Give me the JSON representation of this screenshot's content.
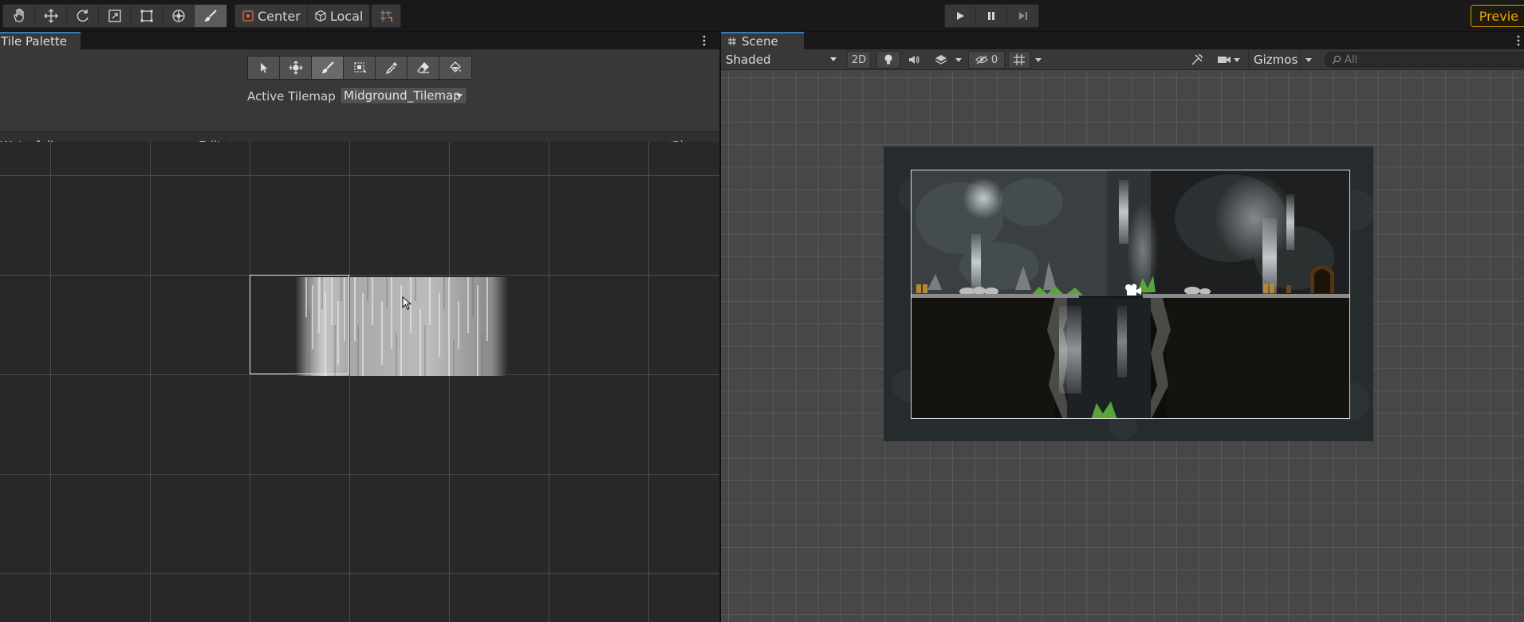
{
  "toolbar": {
    "tools": [
      {
        "name": "hand-tool-icon"
      },
      {
        "name": "move-tool-icon"
      },
      {
        "name": "rotate-tool-icon"
      },
      {
        "name": "scale-tool-icon"
      },
      {
        "name": "rect-tool-icon"
      },
      {
        "name": "transform-tool-icon"
      },
      {
        "name": "brush-tool-icon"
      }
    ],
    "pivot_label": "Center",
    "space_label": "Local",
    "preview_label": "Previe"
  },
  "tile_palette": {
    "tab_label": "Tile Palette",
    "active_tilemap_label": "Active Tilemap",
    "active_tilemap_value": "Midground_Tilemap",
    "palette_name": "Waterfalls",
    "edit_label": "Edit",
    "gizmos_label": "Gizmos"
  },
  "scene": {
    "tab_label": "Scene",
    "shading_mode": "Shaded",
    "mode_2d_label": "2D",
    "hidden_count": "0",
    "gizmos_label": "Gizmos",
    "search_placeholder": "All"
  },
  "colors": {
    "accent_tab": "#3a79bb",
    "preview_border": "#d89a00",
    "panel_bg": "#282828",
    "scene_bg": "#474747"
  }
}
